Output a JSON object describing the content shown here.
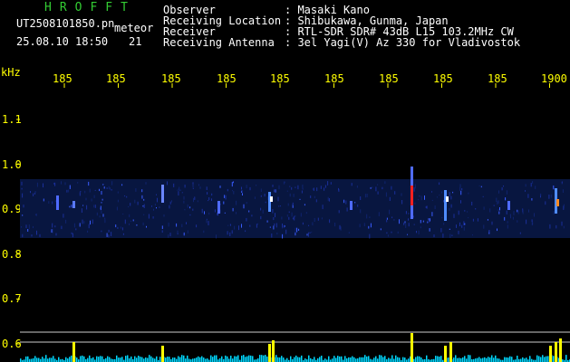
{
  "logo": "HROFFT",
  "file": {
    "name": "UT2508101850.pn",
    "tag": "meteor",
    "datetime": "25.08.10 18:50",
    "frame": "21"
  },
  "info": [
    {
      "label": "Observer",
      "value": ": Masaki Kano"
    },
    {
      "label": "Receiving Location",
      "value": ": Shibukawa, Gunma, Japan"
    },
    {
      "label": "Receiver",
      "value": ": RTL-SDR SDR# 43dB L15 103.2MHz CW"
    },
    {
      "label": "Receiving Antenna",
      "value": ": 3el Yagi(V) Az 330 for Vladivostok"
    }
  ],
  "axes": {
    "y_unit": "kHz",
    "y_ticks": [
      "1.1",
      "1.0",
      "0.9",
      "0.8",
      "0.7",
      "0.6"
    ],
    "x_ticks": [
      "185",
      "185",
      "185",
      "185",
      "185",
      "185",
      "185",
      "185",
      "185",
      "1900"
    ]
  },
  "colors": {
    "background": "#000000",
    "text": "#ffffff",
    "logo": "#33cc33",
    "axis": "#ffff00",
    "signal_bg": "#0a1a5c",
    "signal_hot": "#ff2020",
    "levels": "#00e5ff"
  }
}
